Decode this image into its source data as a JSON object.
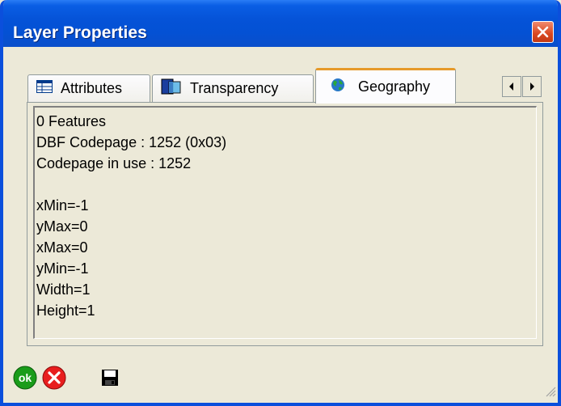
{
  "window": {
    "title": "Layer Properties"
  },
  "tabs": [
    {
      "label": "Attributes",
      "icon": "table-icon"
    },
    {
      "label": "Transparency",
      "icon": "transparency-icon"
    },
    {
      "label": "Geography",
      "icon": "globe-icon",
      "active": true
    }
  ],
  "content": {
    "lines_top": [
      "0 Features",
      "DBF Codepage : 1252 (0x03)",
      "Codepage in use : 1252"
    ],
    "lines_bottom": [
      "xMin=-1",
      "yMax=0",
      "xMax=0",
      "yMin=-1",
      "Width=1",
      "Height=1"
    ]
  },
  "bottom_buttons": [
    {
      "name": "ok",
      "label": "ok",
      "color": "#1a9c1a"
    },
    {
      "name": "cancel",
      "color": "#e81e1e"
    },
    {
      "name": "save",
      "icon": "floppy-icon"
    }
  ],
  "colors": {
    "title_bar": "#0553d8",
    "close": "#d8471f",
    "active_tab_accent": "#e69a2a"
  }
}
